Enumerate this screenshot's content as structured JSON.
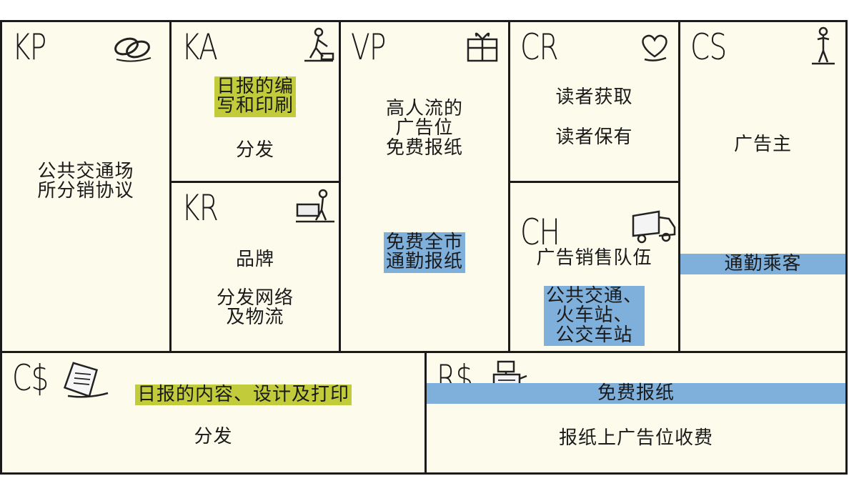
{
  "kp": {
    "code": "KP",
    "icon": "chain-link-icon",
    "lines": [
      "公共交通场",
      "所分销协议"
    ]
  },
  "ka": {
    "code": "KA",
    "icon": "worker-icon",
    "highlight_lines": [
      "日报的编",
      "写和印刷"
    ],
    "text": "分发"
  },
  "kr": {
    "code": "KR",
    "icon": "worker-with-machine-icon",
    "text1": "品牌",
    "lines": [
      "分发网络",
      "及物流"
    ]
  },
  "vp": {
    "code": "VP",
    "icon": "gift-icon",
    "lines": [
      "高人流的",
      "广告位",
      "免费报纸"
    ],
    "highlight_lines": [
      "免费全市",
      "通勤报纸"
    ]
  },
  "cr": {
    "code": "CR",
    "icon": "heart-icon",
    "text1": "读者获取",
    "text2": "读者保有"
  },
  "ch": {
    "code": "CH",
    "icon": "truck-icon",
    "text": "广告销售队伍",
    "highlight_lines": [
      "公共交通、",
      "火车站、",
      "公交车站"
    ]
  },
  "cs": {
    "code": "CS",
    "icon": "person-icon",
    "text": "广告主",
    "highlight": "通勤乘客"
  },
  "cost": {
    "code": "C$",
    "icon": "document-icon",
    "highlight": "日报的内容、设计及打印",
    "text": "分发"
  },
  "revenue": {
    "code": "R$",
    "icon": "cash-register-icon",
    "highlight": "免费报纸",
    "text": "报纸上广告位收费"
  },
  "colors": {
    "background": "#fdfcec",
    "border": "#1b1b1b",
    "highlight_yellow": "#c2cc3a",
    "highlight_blue": "#7fb0dc"
  }
}
